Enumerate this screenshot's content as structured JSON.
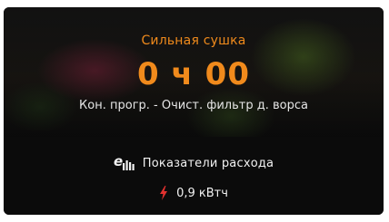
{
  "program": {
    "name": "Сильная сушка",
    "remaining_time": "0 ч 00",
    "end_info": "Кон. прогр. - Очист. фильтр д. ворса"
  },
  "consumption": {
    "title": "Показатели расхода",
    "icon": "eco-consumption-icon",
    "energy_icon": "lightning-icon",
    "energy_value": "0,9 кВтч"
  },
  "colors": {
    "accent": "#f08a1c",
    "energy": "#e2312f",
    "text": "#f2f2f2",
    "background": "#0b0b0b"
  }
}
